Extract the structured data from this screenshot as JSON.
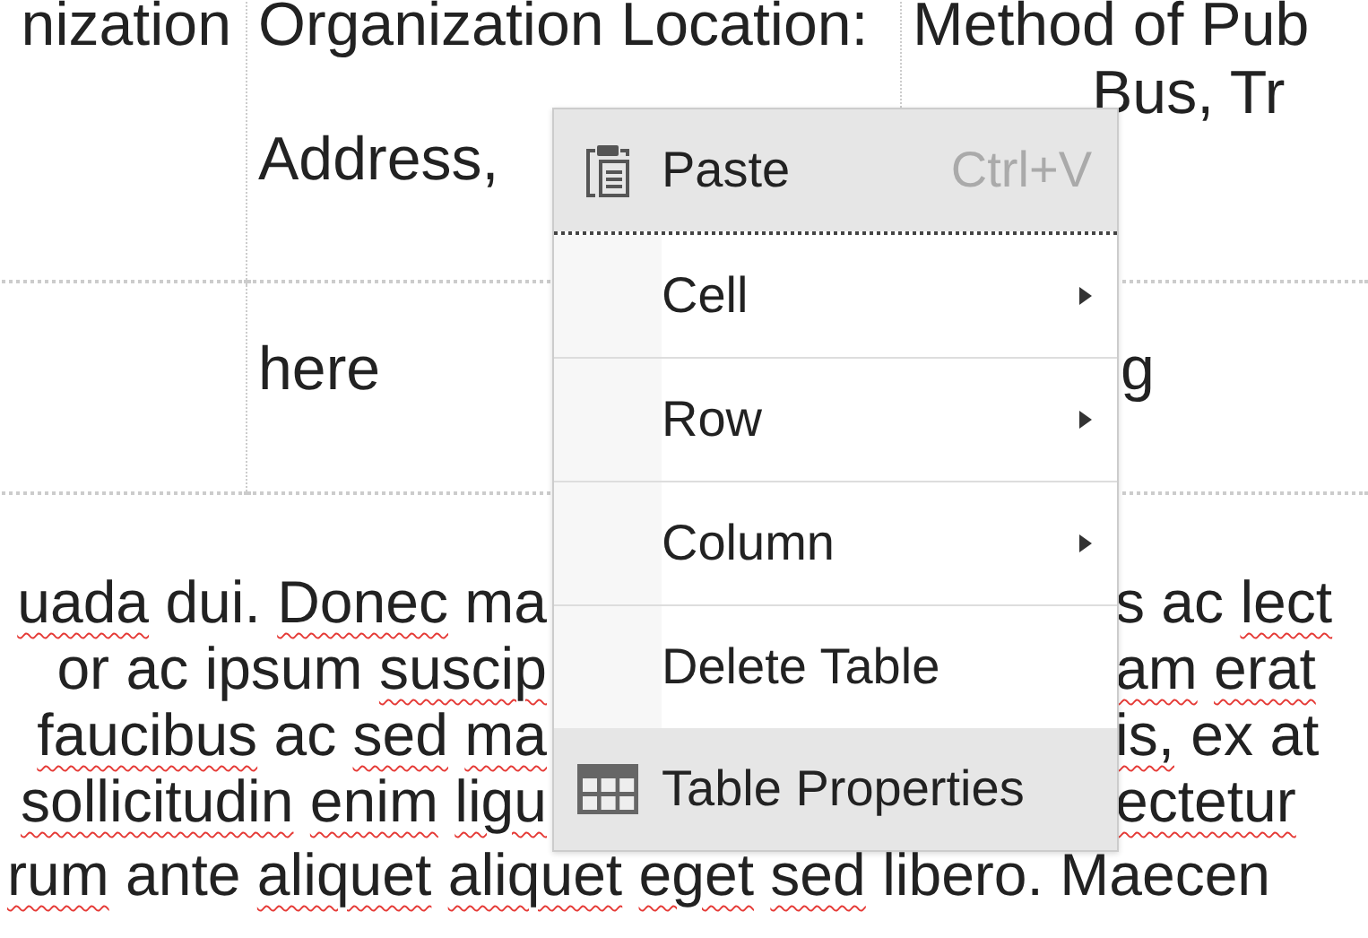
{
  "table": {
    "rows": [
      {
        "cells": [
          {
            "lines": [
              "nization"
            ]
          },
          {
            "lines": [
              "Organization Location:",
              "Address,"
            ]
          },
          {
            "lines": [
              "Method of Pub",
              "Bus, Tr"
            ]
          }
        ]
      },
      {
        "cells": [
          {},
          {
            "lines": [
              "here"
            ]
          },
          {
            "lines": [
              "g"
            ]
          }
        ]
      }
    ]
  },
  "paragraph": {
    "lines": [
      {
        "left": [
          {
            "text": "uada",
            "misspelled": true
          },
          {
            "text": "dui.",
            "misspelled": false
          },
          {
            "text": "Donec",
            "misspelled": true
          },
          {
            "text": "ma",
            "misspelled": false
          }
        ],
        "right": [
          {
            "text": "s",
            "misspelled": false
          },
          {
            "text": "ac",
            "misspelled": false
          },
          {
            "text": "lect",
            "misspelled": true
          }
        ]
      },
      {
        "left": [
          {
            "text": "or",
            "misspelled": false
          },
          {
            "text": "ac",
            "misspelled": false
          },
          {
            "text": "ipsum",
            "misspelled": false
          },
          {
            "text": "suscip",
            "misspelled": true
          }
        ],
        "right": [
          {
            "text": "am",
            "misspelled": true
          },
          {
            "text": "erat",
            "misspelled": true
          }
        ]
      },
      {
        "left": [
          {
            "text": "faucibus",
            "misspelled": true
          },
          {
            "text": "ac",
            "misspelled": false
          },
          {
            "text": "sed",
            "misspelled": true
          },
          {
            "text": "ma",
            "misspelled": true
          }
        ],
        "right": [
          {
            "text": "is,",
            "misspelled": true
          },
          {
            "text": "ex",
            "misspelled": false
          },
          {
            "text": "at",
            "misspelled": false
          }
        ]
      },
      {
        "left": [
          {
            "text": "sollicitudin",
            "misspelled": true
          },
          {
            "text": "enim",
            "misspelled": true
          },
          {
            "text": "ligu",
            "misspelled": true
          }
        ],
        "right": [
          {
            "text": "ectetur",
            "misspelled": true
          }
        ]
      },
      {
        "left": [
          {
            "text": "rum",
            "misspelled": true
          },
          {
            "text": "ante",
            "misspelled": false
          },
          {
            "text": "aliquet",
            "misspelled": true
          },
          {
            "text": "aliquet",
            "misspelled": true
          },
          {
            "text": "eget",
            "misspelled": true
          },
          {
            "text": "sed",
            "misspelled": true
          },
          {
            "text": "libero.",
            "misspelled": false
          },
          {
            "text": "Maecen",
            "misspelled": false
          }
        ]
      }
    ]
  },
  "context_menu": {
    "items": [
      {
        "kind": "paste",
        "label": "Paste",
        "shortcut": "Ctrl+V",
        "highlighted": true
      },
      {
        "kind": "separator",
        "dotted": true
      },
      {
        "kind": "submenu",
        "label": "Cell",
        "highlighted": false
      },
      {
        "kind": "separator",
        "dotted": false
      },
      {
        "kind": "submenu",
        "label": "Row",
        "highlighted": false
      },
      {
        "kind": "separator",
        "dotted": false
      },
      {
        "kind": "submenu",
        "label": "Column",
        "highlighted": false
      },
      {
        "kind": "separator",
        "dotted": false
      },
      {
        "kind": "command",
        "label": "Delete Table",
        "highlighted": false
      },
      {
        "kind": "properties",
        "label": "Table Properties",
        "highlighted": true
      }
    ]
  }
}
